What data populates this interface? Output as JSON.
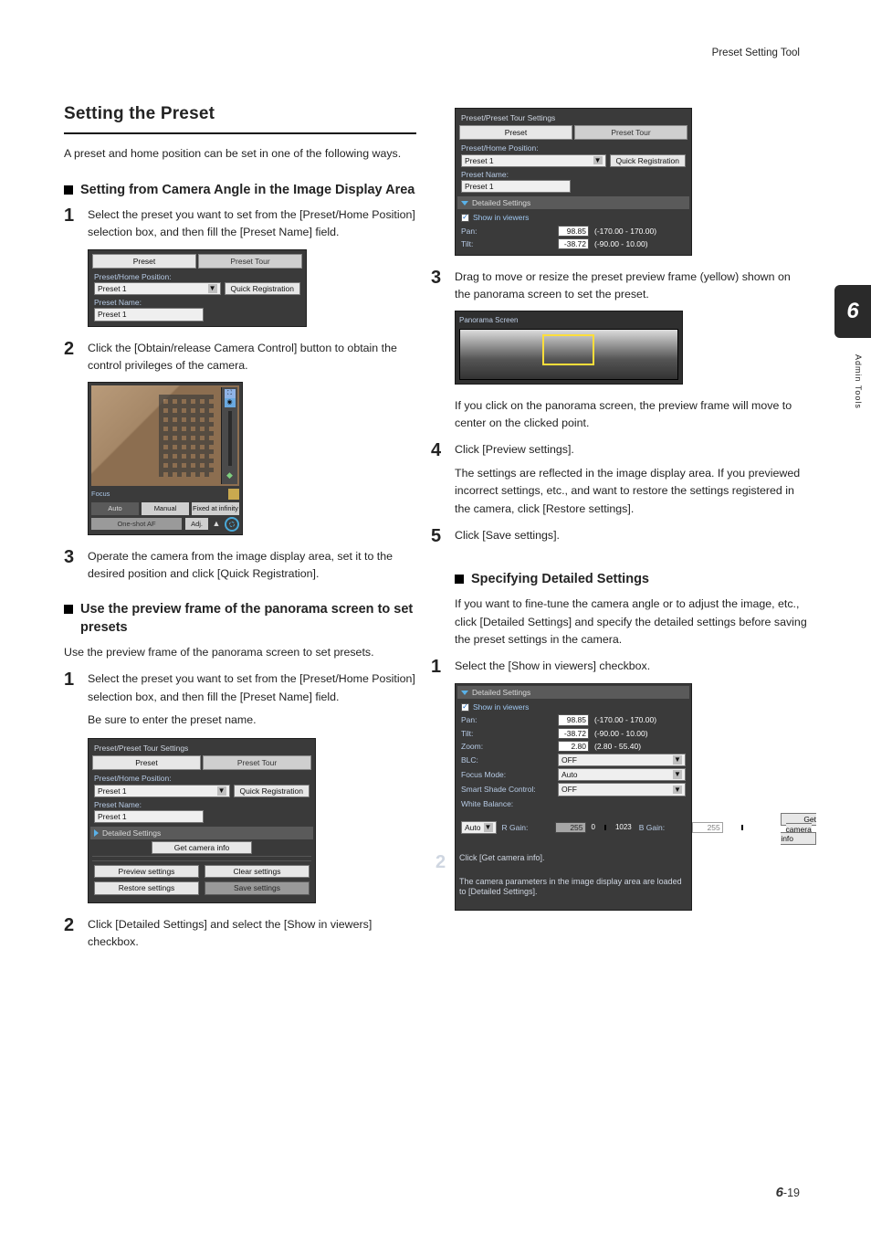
{
  "header": {
    "tool_name": "Preset Setting Tool"
  },
  "chapter": {
    "number": "6",
    "side_label": "Admin Tools",
    "page": "19"
  },
  "left": {
    "h1": "Setting the Preset",
    "intro": "A preset and home position can be set in one of the following ways.",
    "subA": "Setting from Camera Angle in the Image Display Area",
    "stepA1": "Select the preset you want to set from the [Preset/Home Position] selection box, and then fill the [Preset Name] field.",
    "stepA2": "Click the [Obtain/release Camera Control] button to obtain the control privileges of the camera.",
    "stepA3": "Operate the camera from the image display area, set it to the desired position and click [Quick Registration].",
    "subB": "Use the preview frame of the panorama screen to set presets",
    "subB_intro": "Use the preview frame of the panorama screen to set presets.",
    "stepB1": "Select the preset you want to set from the [Preset/Home Position] selection box, and then fill the [Preset Name] field.",
    "stepB1_note": "Be sure to enter the preset name.",
    "stepB2": "Click [Detailed Settings] and select the [Show in viewers] checkbox."
  },
  "right": {
    "step3": "Drag to move or resize the preset preview frame (yellow) shown on the panorama screen to set the preset.",
    "step3_note": "If you click on the panorama screen, the preview frame will move to center on the clicked point.",
    "step4": "Click [Preview settings].",
    "step4_note": "The settings are reflected in the image display area. If you previewed incorrect settings, etc., and want to restore the settings registered in the camera, click [Restore settings].",
    "step5": "Click [Save settings].",
    "subC": "Specifying Detailed Settings",
    "subC_intro": "If you want to fine-tune the camera angle or to adjust the image, etc., click [Detailed Settings] and specify the detailed settings before saving the preset settings in the camera.",
    "stepC1": "Select the [Show in viewers] checkbox.",
    "stepC2": "Click [Get camera info].",
    "stepC2_note": "The camera parameters in the image display area are loaded to [Detailed Settings]."
  },
  "ui": {
    "panel_title": "Preset/Preset Tour Settings",
    "tab_preset": "Preset",
    "tab_tour": "Preset Tour",
    "lbl_pos": "Preset/Home Position:",
    "sel_pos": "Preset 1",
    "btn_quick": "Quick Registration",
    "lbl_name": "Preset Name:",
    "val_name": "Preset 1",
    "detailed_settings": "Detailed Settings",
    "get_camera_info": "Get camera info",
    "preview_settings": "Preview settings",
    "clear_settings": "Clear settings",
    "restore_settings": "Restore settings",
    "save_settings": "Save settings",
    "show_in_viewers": "Show in viewers",
    "pan_lbl": "Pan:",
    "pan_val": "98.85",
    "pan_range": "(-170.00 - 170.00)",
    "tilt_lbl": "Tilt:",
    "tilt_val": "-38.72",
    "tilt_range": "(-90.00 - 10.00)",
    "zoom_lbl": "Zoom:",
    "zoom_val": "2.80",
    "zoom_range": "(2.80 - 55.40)",
    "blc_lbl": "BLC:",
    "blc_val": "OFF",
    "focus_mode_lbl": "Focus Mode:",
    "focus_mode_val": "Auto",
    "ssc_lbl": "Smart Shade Control:",
    "ssc_val": "OFF",
    "wb_lbl": "White Balance:",
    "wb_val": "Auto",
    "rgain_lbl": "R Gain:",
    "bgain_lbl": "B Gain:",
    "gain_val": "255",
    "gain_min": "0",
    "gain_max": "1023",
    "cam_focus": "Focus",
    "cam_auto": "Auto",
    "cam_manual": "Manual",
    "cam_fixed": "Fixed at infinity",
    "cam_onepush": "One-shot AF",
    "cam_adj": "Adj.",
    "panorama_title": "Panorama Screen"
  }
}
